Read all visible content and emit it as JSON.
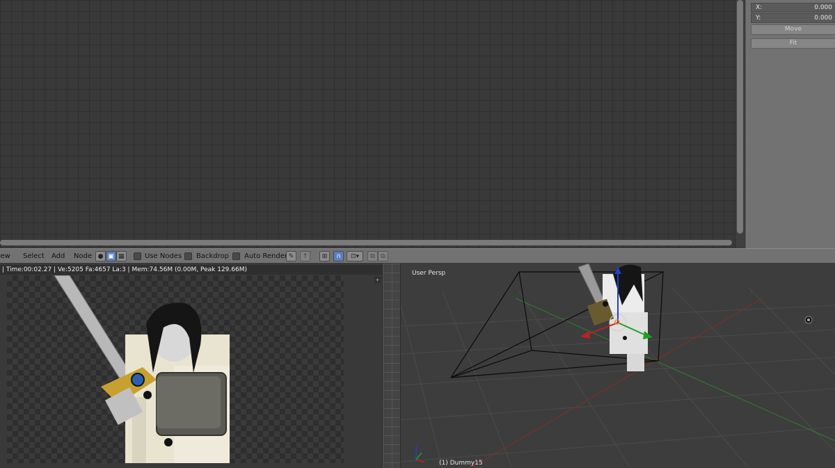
{
  "side_panel": {
    "x_field": {
      "label": "X:",
      "value": "0.000"
    },
    "y_field": {
      "label": "Y:",
      "value": "0.000"
    },
    "move_button": "Move",
    "fit_button": "Fit"
  },
  "node_header": {
    "menus": [
      "View",
      "Select",
      "Add",
      "Node"
    ],
    "checkboxes": {
      "use_nodes": "Use Nodes",
      "backdrop": "Backdrop",
      "auto_render": "Auto Render"
    }
  },
  "render": {
    "status": "| Time:00:02.27 | Ve:5205 Fa:4657 La:3 | Mem:74.56M (0.00M, Peak 129.66M)"
  },
  "viewport": {
    "title": "User Persp",
    "object_label": "(1) Dummy15"
  },
  "colors": {
    "accent": "#5a80c0",
    "axis_x": "#c02020",
    "axis_y": "#20a020",
    "axis_z": "#2040d0"
  }
}
